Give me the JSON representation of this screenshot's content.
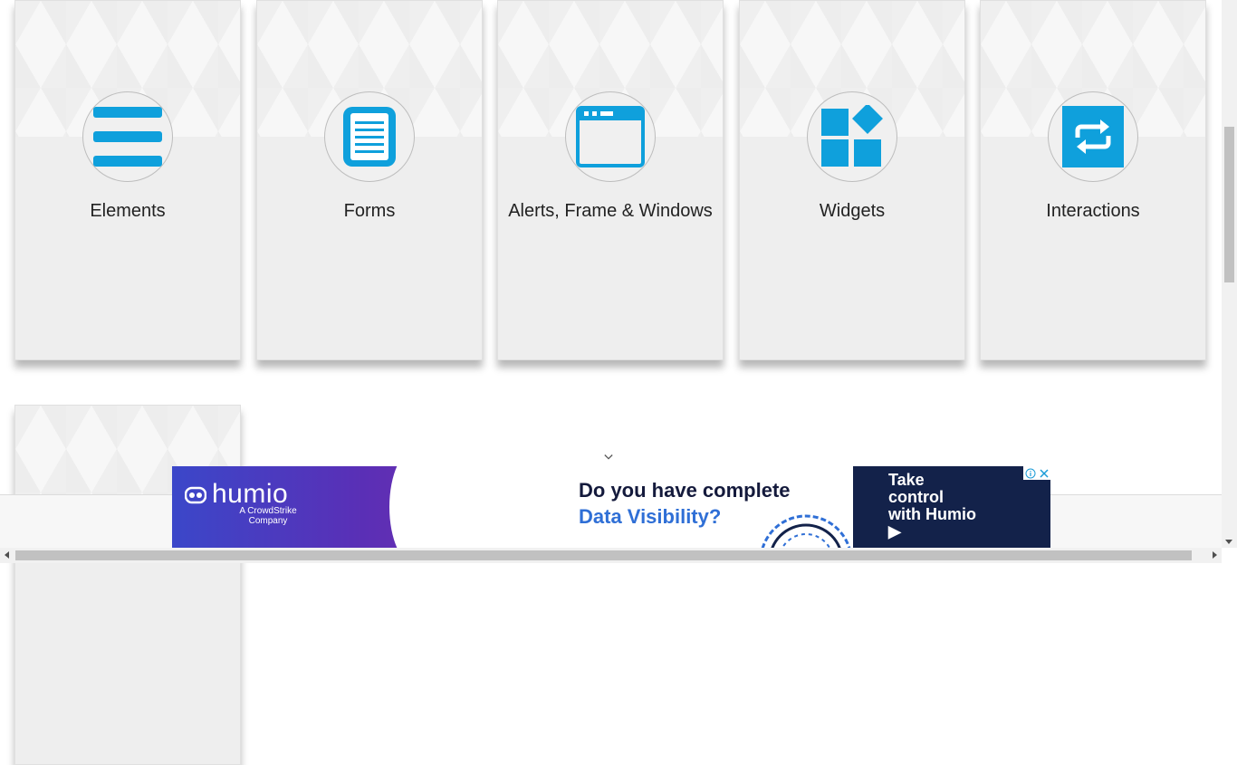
{
  "cards": [
    {
      "title": "Elements",
      "icon": "menu-lines-icon"
    },
    {
      "title": "Forms",
      "icon": "document-icon"
    },
    {
      "title": "Alerts, Frame & Windows",
      "icon": "browser-window-icon"
    },
    {
      "title": "Widgets",
      "icon": "widgets-blocks-icon"
    },
    {
      "title": "Interactions",
      "icon": "repeat-arrows-icon"
    },
    {
      "title": "",
      "icon": ""
    }
  ],
  "colors": {
    "accent": "#0fa0dc",
    "card_bg": "#eeeeee",
    "ad_left": "#4b3bc0",
    "ad_right": "#13224a",
    "ad_blue_text": "#2f6fd6"
  },
  "ad": {
    "brand": "humio",
    "brand_sub": "A CrowdStrike Company",
    "headline_1": "Do you have complete",
    "headline_2": "Data Visibility?",
    "cta": "Take control with Humio ▶",
    "info_icon": "info-icon",
    "close_icon": "close-icon"
  }
}
